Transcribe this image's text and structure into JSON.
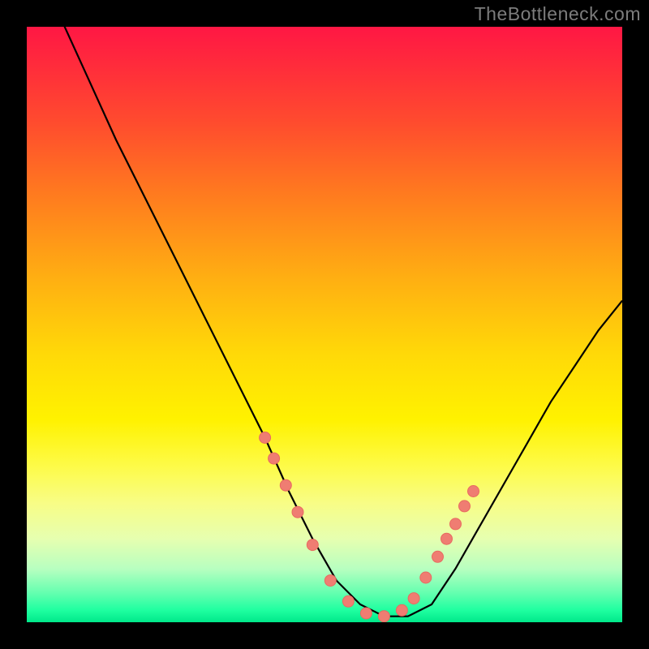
{
  "watermark": "TheBottleneck.com",
  "colors": {
    "background": "#000000",
    "curve_stroke": "#000000",
    "marker_fill": "#ef7d72",
    "marker_stroke": "#e86a60"
  },
  "chart_data": {
    "type": "line",
    "title": "",
    "xlabel": "",
    "ylabel": "",
    "xlim": [
      0,
      100
    ],
    "ylim": [
      0,
      100
    ],
    "grid": false,
    "series": [
      {
        "name": "bottleneck-curve",
        "x": [
          0,
          5,
          10,
          15,
          20,
          25,
          30,
          35,
          40,
          44,
          48,
          52,
          56,
          60,
          64,
          68,
          72,
          76,
          80,
          84,
          88,
          92,
          96,
          100
        ],
        "values": [
          114,
          103,
          92,
          81,
          71,
          61,
          51,
          41,
          31,
          22,
          14,
          7,
          3,
          1,
          1,
          3,
          9,
          16,
          23,
          30,
          37,
          43,
          49,
          54
        ]
      }
    ],
    "markers": {
      "name": "highlighted-points",
      "x": [
        40.0,
        41.5,
        43.5,
        45.5,
        48.0,
        51.0,
        54.0,
        57.0,
        60.0,
        63.0,
        65.0,
        67.0,
        69.0,
        70.5,
        72.0,
        73.5,
        75.0
      ],
      "values": [
        31.0,
        27.5,
        23.0,
        18.5,
        13.0,
        7.0,
        3.5,
        1.5,
        1.0,
        2.0,
        4.0,
        7.5,
        11.0,
        14.0,
        16.5,
        19.5,
        22.0
      ]
    }
  }
}
